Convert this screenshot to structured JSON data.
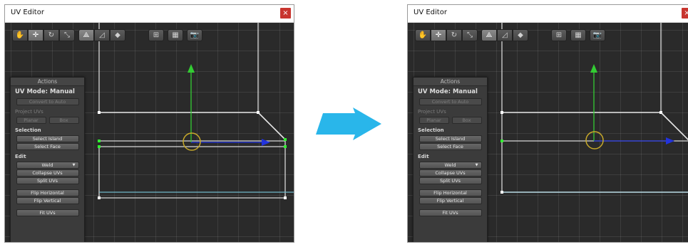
{
  "window_title": "UV Editor",
  "close_glyph": "×",
  "toolbar": {
    "tools": [
      {
        "icon": "hand-icon",
        "glyph": "✋"
      },
      {
        "icon": "move-icon",
        "glyph": "✛"
      },
      {
        "icon": "rotate-icon",
        "glyph": "↻"
      },
      {
        "icon": "scale-icon",
        "glyph": "⤡"
      }
    ],
    "select_modes": [
      {
        "icon": "vertex-select-icon",
        "glyph": "⟁"
      },
      {
        "icon": "edge-select-icon",
        "glyph": "◿"
      },
      {
        "icon": "face-select-icon",
        "glyph": "◆"
      }
    ],
    "extras": [
      {
        "icon": "uv-grid-icon",
        "glyph": "⊞"
      },
      {
        "icon": "texture-icon",
        "glyph": "▦"
      },
      {
        "icon": "camera-icon",
        "glyph": "📷"
      }
    ]
  },
  "panel": {
    "header": "Actions",
    "mode": "UV Mode: Manual",
    "convert_to_auto": "Convert to Auto",
    "project_uvs_label": "Project UVs",
    "planar": "Planar",
    "box": "Box",
    "selection_label": "Selection",
    "select_island": "Select Island",
    "select_face": "Select Face",
    "edit_label": "Edit",
    "weld": "Weld",
    "weld_arrow": "▼",
    "collapse_uvs": "Collapse UVs",
    "split_uvs": "Split UVs",
    "flip_horizontal": "Flip Horizontal",
    "flip_vertical": "Flip Vertical",
    "fit_uvs": "Fit UVs"
  },
  "colors": {
    "transition_arrow": "#29b6ea",
    "close_button": "#c8352f",
    "handle_y": "#33cc33",
    "handle_x": "#2233dd",
    "pivot_circle": "#c7a92a",
    "selected_vertex": "#33ee33",
    "outline_edge": "#d8d8d8",
    "seam_edge": "#6fb7c8"
  }
}
